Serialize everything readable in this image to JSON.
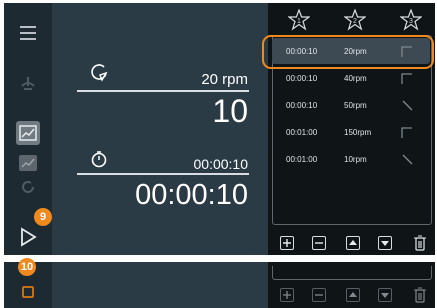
{
  "readouts": {
    "speed_value": "20 rpm",
    "count_value": "10",
    "time_small": "00:00:10",
    "time_large": "00:00:10"
  },
  "badges": {
    "play_badge": "9",
    "stop_badge": "10"
  },
  "stars": [
    "1",
    "2",
    "3"
  ],
  "steps": [
    {
      "time": "00:00:10",
      "speed": "20rpm",
      "curve": "step-icon"
    },
    {
      "time": "00:00:10",
      "speed": "40rpm",
      "curve": "step-icon"
    },
    {
      "time": "00:00:10",
      "speed": "50rpm",
      "curve": "ramp-down-icon"
    },
    {
      "time": "00:01:00",
      "speed": "150rpm",
      "curve": "step-icon"
    },
    {
      "time": "00:01:00",
      "speed": "10rpm",
      "curve": "ramp-down-icon"
    }
  ],
  "colors": {
    "accent": "#f08a1e",
    "panel": "#2b3b46",
    "list_bg": "#0f1417"
  }
}
